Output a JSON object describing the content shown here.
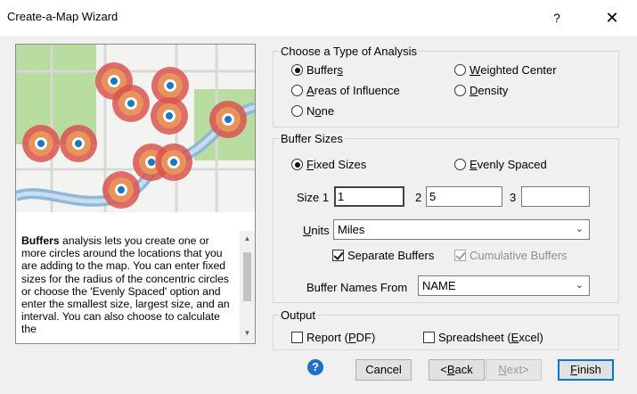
{
  "window": {
    "title": "Create-a-Map Wizard",
    "help_glyph": "?",
    "close_glyph": "✕"
  },
  "description": {
    "bold_term": "Buffers",
    "text": " analysis lets you create one or more circles around the locations that you are adding to the map. You can enter fixed sizes for the radius of the concentric circles or choose the 'Evenly Spaced' option and enter the smallest size, largest size, and an interval. You can also choose to calculate the"
  },
  "analysis": {
    "legend": "Choose a Type of Analysis",
    "options": [
      {
        "pre": "Buffer",
        "u": "s",
        "post": "",
        "selected": true
      },
      {
        "pre": "",
        "u": "W",
        "post": "eighted Center",
        "selected": false
      },
      {
        "pre": "",
        "u": "A",
        "post": "reas of Influence",
        "selected": false
      },
      {
        "pre": "",
        "u": "D",
        "post": "ensity",
        "selected": false
      },
      {
        "pre": "N",
        "u": "o",
        "post": "ne",
        "selected": false
      }
    ]
  },
  "buffer_sizes": {
    "legend": "Buffer Sizes",
    "fixed": {
      "u": "F",
      "post": "ixed Sizes",
      "selected": true
    },
    "evenly": {
      "u": "E",
      "post": "venly Spaced",
      "selected": false
    },
    "size1_label": "Size 1",
    "size2_label": "2",
    "size3_label": "3",
    "size1": "1",
    "size2": "5",
    "size3": "",
    "units_label_u": "U",
    "units_label_post": "nits",
    "units_value": "Miles",
    "separate_label": "Separate Buffers",
    "separate_checked": true,
    "cumulative_label": "Cumulative Buffers",
    "cumulative_checked": true,
    "names_from_label": "Buffer Names From",
    "names_from_value": "NAME"
  },
  "output": {
    "legend": "Output",
    "report": {
      "pre": "Report (",
      "u": "P",
      "post": "DF)",
      "checked": false
    },
    "spreadsheet": {
      "pre": "Spreadsheet (",
      "u": "E",
      "post": "xcel)",
      "checked": false
    }
  },
  "buttons": {
    "help": "?",
    "cancel": "Cancel",
    "back_pre": "<",
    "back_u": "B",
    "back_post": "ack",
    "next_pre": "",
    "next_u": "N",
    "next_post": "ext>",
    "finish_u": "F",
    "finish_post": "inish"
  },
  "colors": {
    "buffer_outer": "#d9534f",
    "buffer_inner": "#e8935c",
    "pin": "#1b78c2",
    "road": "#8fb8d8",
    "park": "#b9dca0",
    "accent": "#0078d7"
  }
}
